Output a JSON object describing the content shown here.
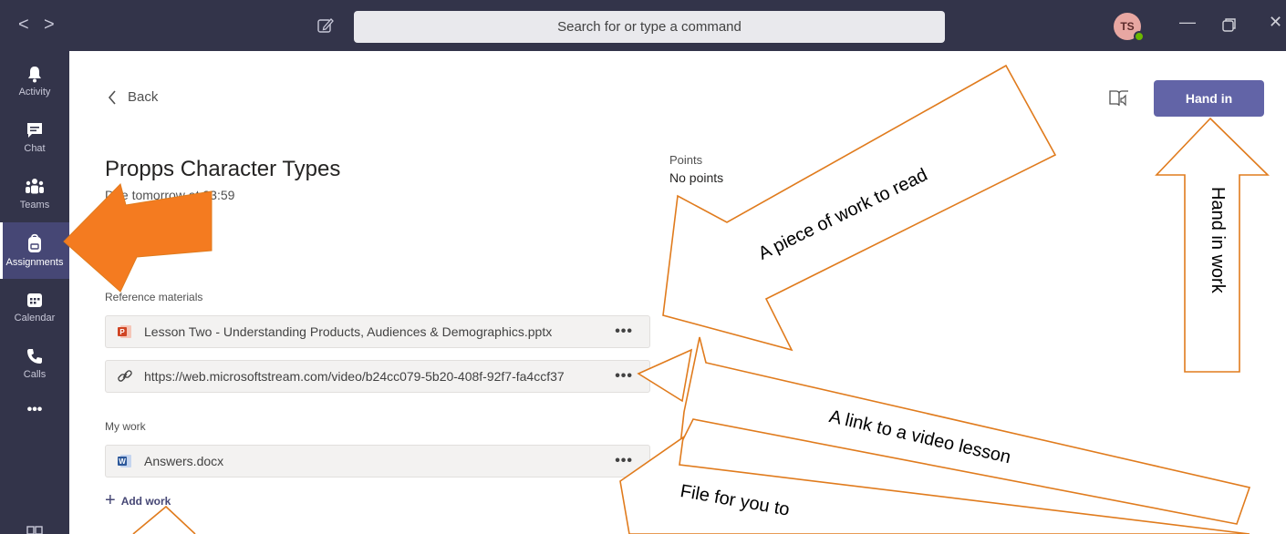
{
  "titlebar": {
    "search_placeholder": "Search for or type a command",
    "avatar_initials": "TS",
    "back_arrow": "<",
    "forward_arrow": ">",
    "minimize": "—",
    "close": "✕"
  },
  "rail": {
    "items": [
      {
        "label": "Activity",
        "icon": "bell-icon"
      },
      {
        "label": "Chat",
        "icon": "chat-icon"
      },
      {
        "label": "Teams",
        "icon": "teams-icon"
      },
      {
        "label": "Assignments",
        "icon": "backpack-icon",
        "active": true
      },
      {
        "label": "Calendar",
        "icon": "calendar-icon"
      },
      {
        "label": "Calls",
        "icon": "phone-icon"
      },
      {
        "label": "•••",
        "icon": "more-icon"
      }
    ]
  },
  "assignment": {
    "back_label": "Back",
    "title": "Propps Character Types",
    "due": "Due tomorrow at 23:59",
    "points_label": "Points",
    "points_value": "No points",
    "hand_in_label": "Hand in",
    "reference_label": "Reference materials",
    "reference_items": [
      {
        "text": "Lesson Two - Understanding Products, Audiences & Demographics.pptx",
        "icon": "powerpoint-icon"
      },
      {
        "text": "https://web.microsoftstream.com/video/b24cc079-5b20-408f-92f7-fa4ccf37",
        "icon": "link-icon"
      }
    ],
    "my_work_label": "My work",
    "my_work_items": [
      {
        "text": "Answers.docx",
        "icon": "word-icon"
      }
    ],
    "more_label": "•••",
    "add_work_label": "Add work"
  },
  "annotations": {
    "read": "A piece of work to read",
    "video": "A link to a video lesson",
    "file": "File for you to",
    "hand_in": "Hand in work"
  },
  "colors": {
    "rail": "#33344a",
    "brand": "#6264a7",
    "callout_stroke": "#e07b1d",
    "callout_fill": "#f47b20"
  }
}
